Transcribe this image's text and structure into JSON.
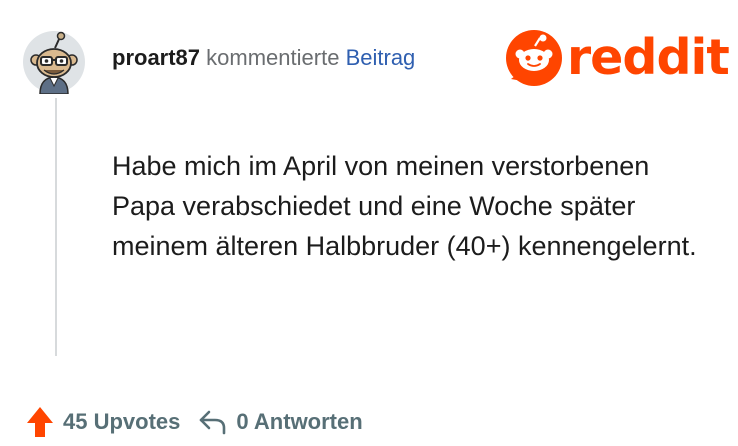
{
  "comment": {
    "username": "proart87",
    "action": "kommentierte",
    "target": "Beitrag",
    "body": "Habe mich im April von meinen verstorbenen Papa verabschiedet und eine Woche später meinem älteren Halbbruder (40+) kennengelernt."
  },
  "logo": {
    "text": "reddit"
  },
  "footer": {
    "upvotes": "45 Upvotes",
    "replies": "0 Antworten"
  },
  "colors": {
    "brand": "#ff4500",
    "link": "#2f5fb0",
    "muted": "#6a6d70",
    "footer_text": "#576f76"
  },
  "icons": {
    "avatar": "snoo-avatar",
    "logo": "reddit-snoo-icon",
    "upvote": "upvote-arrow-icon",
    "reply": "reply-arrow-icon"
  }
}
